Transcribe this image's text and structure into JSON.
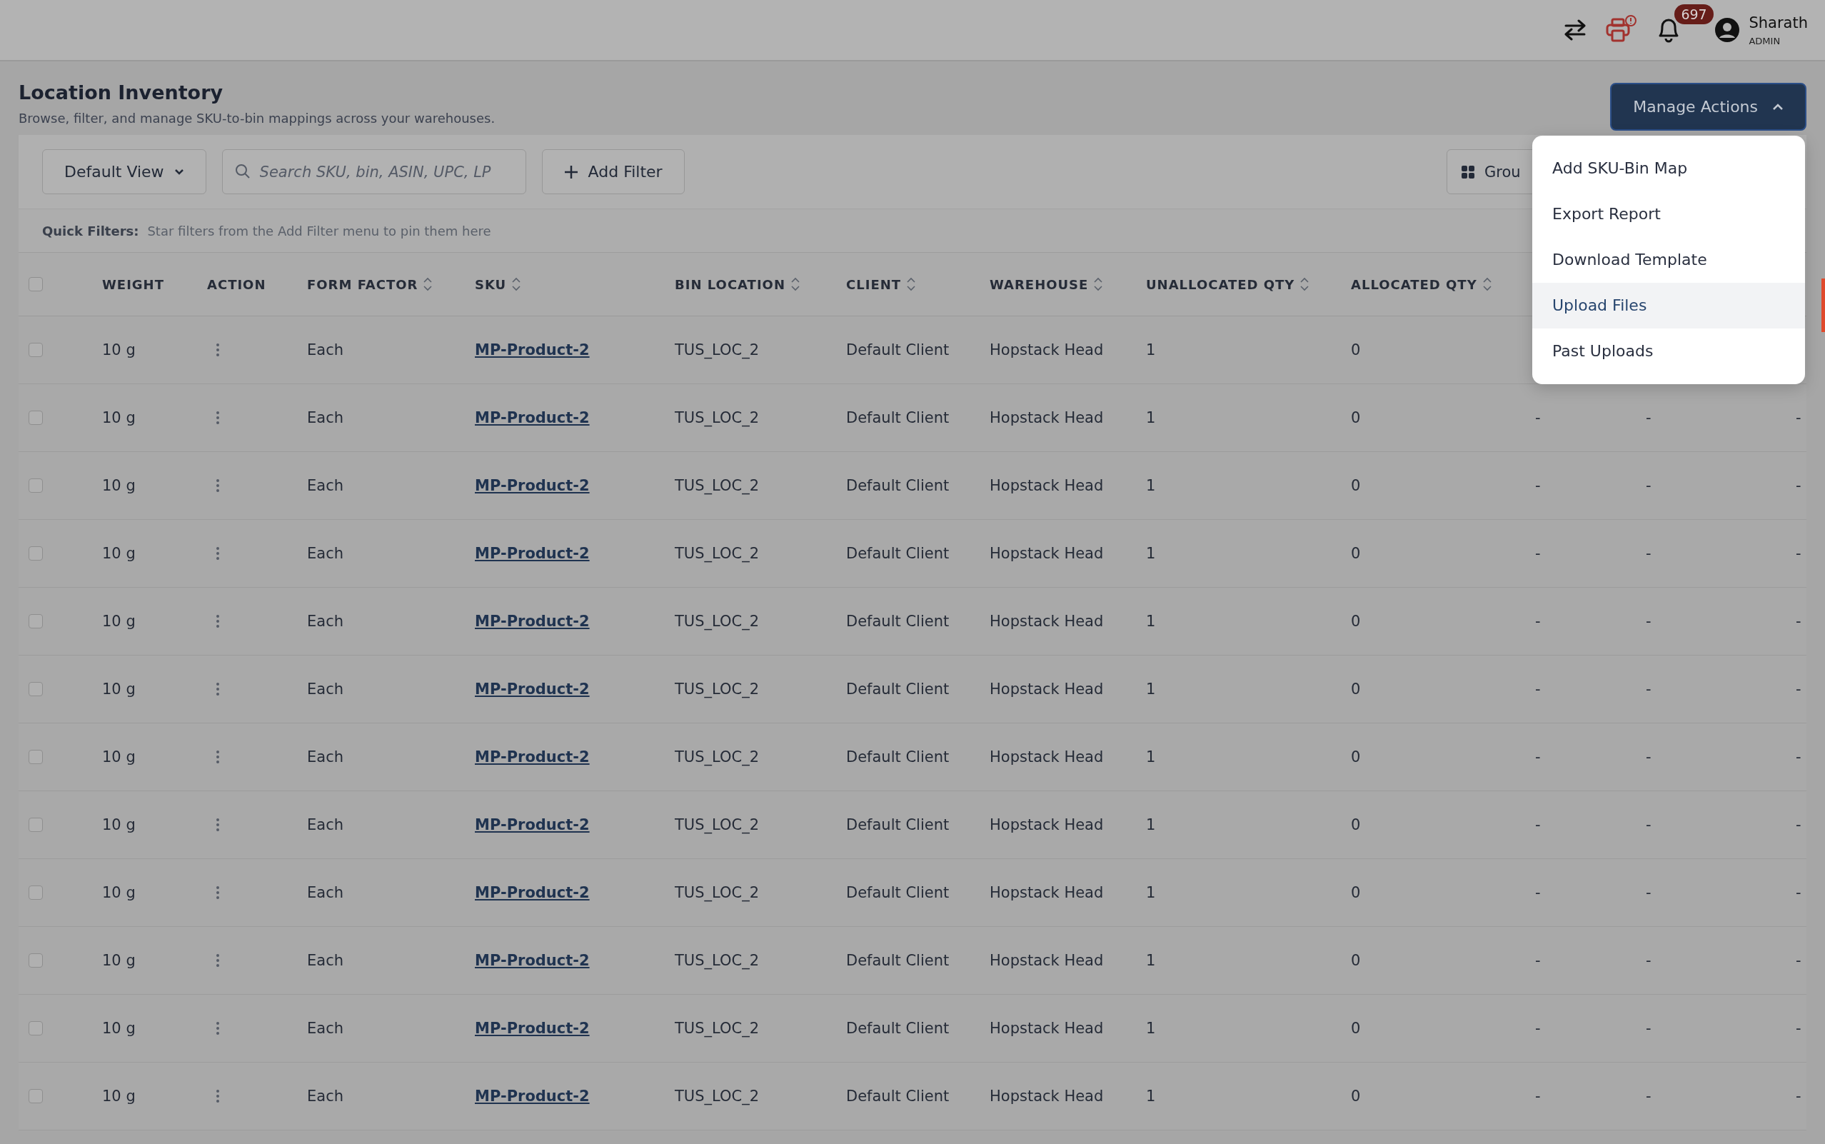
{
  "header": {
    "notification_count": "697",
    "user": {
      "name": "Sharath",
      "role": "ADMIN"
    }
  },
  "page": {
    "title": "Location Inventory",
    "subtitle": "Browse, filter, and manage SKU-to-bin mappings across your warehouses."
  },
  "manage_actions": {
    "label": "Manage Actions",
    "expanded": true,
    "menu": [
      {
        "label": "Add SKU-Bin Map",
        "selected": false
      },
      {
        "label": "Export Report",
        "selected": false
      },
      {
        "label": "Download Template",
        "selected": false
      },
      {
        "label": "Upload Files",
        "selected": true
      },
      {
        "label": "Past Uploads",
        "selected": false
      }
    ]
  },
  "toolbar": {
    "view": "Default View",
    "search": {
      "placeholder": "Search SKU, bin, ASIN, UPC, LP"
    },
    "add_filter": "Add Filter",
    "group": "Grou"
  },
  "quick_filters": {
    "label": "Quick Filters:",
    "hint": "Star filters from the Add Filter menu to pin them here"
  },
  "table": {
    "select_all_checked": false,
    "columns": [
      {
        "label": "WEIGHT",
        "sortable": false
      },
      {
        "label": "ACTION",
        "sortable": false
      },
      {
        "label": "FORM FACTOR",
        "sortable": true
      },
      {
        "label": "SKU",
        "sortable": true
      },
      {
        "label": "BIN LOCATION",
        "sortable": true
      },
      {
        "label": "CLIENT",
        "sortable": true
      },
      {
        "label": "WAREHOUSE",
        "sortable": true
      },
      {
        "label": "UNALLOCATED QTY",
        "sortable": true
      },
      {
        "label": "ALLOCATED QTY",
        "sortable": true
      }
    ],
    "rows": [
      {
        "checked": false,
        "weight": "10 g",
        "form_factor": "Each",
        "sku": "MP-Product-2",
        "bin_location": "TUS_LOC_2",
        "client": "Default Client",
        "warehouse": "Hopstack Head",
        "unallocated_qty": "1",
        "allocated_qty": "0"
      },
      {
        "checked": false,
        "weight": "10 g",
        "form_factor": "Each",
        "sku": "MP-Product-2",
        "bin_location": "TUS_LOC_2",
        "client": "Default Client",
        "warehouse": "Hopstack Head",
        "unallocated_qty": "1",
        "allocated_qty": "0",
        "column_10": "-",
        "column_11": "-",
        "column_12": "-"
      },
      {
        "checked": false,
        "weight": "10 g",
        "form_factor": "Each",
        "sku": "MP-Product-2",
        "bin_location": "TUS_LOC_2",
        "client": "Default Client",
        "warehouse": "Hopstack Head",
        "unallocated_qty": "1",
        "allocated_qty": "0",
        "column_10": "-",
        "column_11": "-",
        "column_12": "-"
      },
      {
        "checked": false,
        "weight": "10 g",
        "form_factor": "Each",
        "sku": "MP-Product-2",
        "bin_location": "TUS_LOC_2",
        "client": "Default Client",
        "warehouse": "Hopstack Head",
        "unallocated_qty": "1",
        "allocated_qty": "0",
        "column_10": "-",
        "column_11": "-",
        "column_12": "-"
      },
      {
        "checked": false,
        "weight": "10 g",
        "form_factor": "Each",
        "sku": "MP-Product-2",
        "bin_location": "TUS_LOC_2",
        "client": "Default Client",
        "warehouse": "Hopstack Head",
        "unallocated_qty": "1",
        "allocated_qty": "0",
        "column_10": "-",
        "column_11": "-",
        "column_12": "-"
      },
      {
        "checked": false,
        "weight": "10 g",
        "form_factor": "Each",
        "sku": "MP-Product-2",
        "bin_location": "TUS_LOC_2",
        "client": "Default Client",
        "warehouse": "Hopstack Head",
        "unallocated_qty": "1",
        "allocated_qty": "0",
        "column_10": "-",
        "column_11": "-",
        "column_12": "-"
      },
      {
        "checked": false,
        "weight": "10 g",
        "form_factor": "Each",
        "sku": "MP-Product-2",
        "bin_location": "TUS_LOC_2",
        "client": "Default Client",
        "warehouse": "Hopstack Head",
        "unallocated_qty": "1",
        "allocated_qty": "0",
        "column_10": "-",
        "column_11": "-",
        "column_12": "-"
      },
      {
        "checked": false,
        "weight": "10 g",
        "form_factor": "Each",
        "sku": "MP-Product-2",
        "bin_location": "TUS_LOC_2",
        "client": "Default Client",
        "warehouse": "Hopstack Head",
        "unallocated_qty": "1",
        "allocated_qty": "0",
        "column_10": "-",
        "column_11": "-",
        "column_12": "-"
      },
      {
        "checked": false,
        "weight": "10 g",
        "form_factor": "Each",
        "sku": "MP-Product-2",
        "bin_location": "TUS_LOC_2",
        "client": "Default Client",
        "warehouse": "Hopstack Head",
        "unallocated_qty": "1",
        "allocated_qty": "0",
        "column_10": "-",
        "column_11": "-",
        "column_12": "-"
      },
      {
        "checked": false,
        "weight": "10 g",
        "form_factor": "Each",
        "sku": "MP-Product-2",
        "bin_location": "TUS_LOC_2",
        "client": "Default Client",
        "warehouse": "Hopstack Head",
        "unallocated_qty": "1",
        "allocated_qty": "0",
        "column_10": "-",
        "column_11": "-",
        "column_12": "-"
      },
      {
        "checked": false,
        "weight": "10 g",
        "form_factor": "Each",
        "sku": "MP-Product-2",
        "bin_location": "TUS_LOC_2",
        "client": "Default Client",
        "warehouse": "Hopstack Head",
        "unallocated_qty": "1",
        "allocated_qty": "0",
        "column_10": "-",
        "column_11": "-",
        "column_12": "-"
      },
      {
        "checked": false,
        "weight": "10 g",
        "form_factor": "Each",
        "sku": "MP-Product-2",
        "bin_location": "TUS_LOC_2",
        "client": "Default Client",
        "warehouse": "Hopstack Head",
        "unallocated_qty": "1",
        "allocated_qty": "0",
        "column_10": "-",
        "column_11": "-",
        "column_12": "-"
      }
    ]
  }
}
